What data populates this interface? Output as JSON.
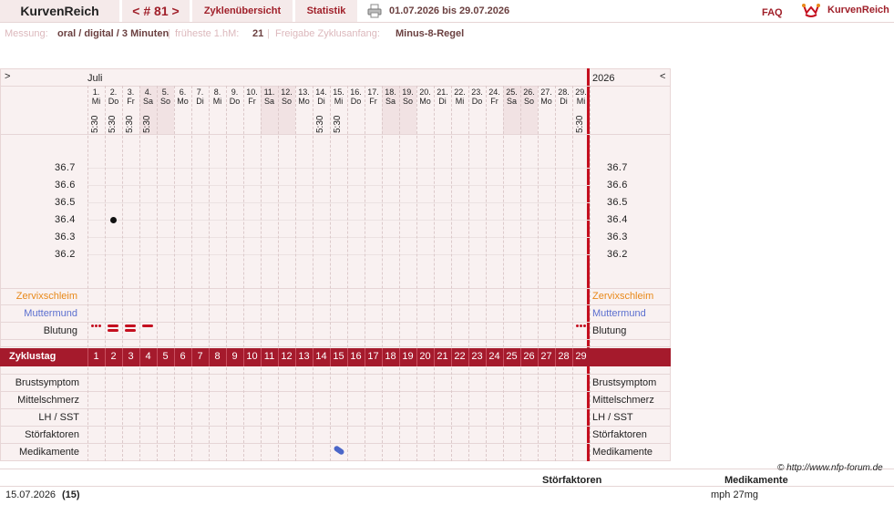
{
  "topbar": {
    "app": "KurvenReich",
    "cycle_nav": "< # 81 >",
    "tab_overview": "Zyklenübersicht",
    "tab_stats": "Statistik",
    "date_range": "01.07.2026 bis 29.07.2026",
    "faq": "FAQ",
    "logo_text": "KurvenReich"
  },
  "measurement": {
    "label_messung": "Messung:",
    "value_messung": "oral / digital / 3 Minuten",
    "label_earliest": "früheste 1.hM:",
    "value_earliest": "21",
    "label_release": "Freigabe Zyklusanfang:",
    "value_release": "Minus-8-Regel",
    "sep": "|"
  },
  "chart": {
    "left_arrow": ">",
    "right_arrow": "<",
    "month": "Juli",
    "year": "2026",
    "days": [
      {
        "n": "1.",
        "d": "Mi",
        "t": "5:30"
      },
      {
        "n": "2.",
        "d": "Do",
        "t": "5:30"
      },
      {
        "n": "3.",
        "d": "Fr",
        "t": "5:30"
      },
      {
        "n": "4.",
        "d": "Sa",
        "t": "5:30"
      },
      {
        "n": "5.",
        "d": "So",
        "t": ""
      },
      {
        "n": "6.",
        "d": "Mo",
        "t": ""
      },
      {
        "n": "7.",
        "d": "Di",
        "t": ""
      },
      {
        "n": "8.",
        "d": "Mi",
        "t": ""
      },
      {
        "n": "9.",
        "d": "Do",
        "t": ""
      },
      {
        "n": "10.",
        "d": "Fr",
        "t": ""
      },
      {
        "n": "11.",
        "d": "Sa",
        "t": ""
      },
      {
        "n": "12.",
        "d": "So",
        "t": ""
      },
      {
        "n": "13.",
        "d": "Mo",
        "t": ""
      },
      {
        "n": "14.",
        "d": "Di",
        "t": "5:30"
      },
      {
        "n": "15.",
        "d": "Mi",
        "t": "5:30"
      },
      {
        "n": "16.",
        "d": "Do",
        "t": ""
      },
      {
        "n": "17.",
        "d": "Fr",
        "t": ""
      },
      {
        "n": "18.",
        "d": "Sa",
        "t": ""
      },
      {
        "n": "19.",
        "d": "So",
        "t": ""
      },
      {
        "n": "20.",
        "d": "Mo",
        "t": ""
      },
      {
        "n": "21.",
        "d": "Di",
        "t": ""
      },
      {
        "n": "22.",
        "d": "Mi",
        "t": ""
      },
      {
        "n": "23.",
        "d": "Do",
        "t": ""
      },
      {
        "n": "24.",
        "d": "Fr",
        "t": ""
      },
      {
        "n": "25.",
        "d": "Sa",
        "t": ""
      },
      {
        "n": "26.",
        "d": "So",
        "t": ""
      },
      {
        "n": "27.",
        "d": "Mo",
        "t": ""
      },
      {
        "n": "28.",
        "d": "Di",
        "t": ""
      },
      {
        "n": "29.",
        "d": "Mi",
        "t": "5:30"
      }
    ],
    "temps": [
      "36.7",
      "36.6",
      "36.5",
      "36.4",
      "36.3",
      "36.2"
    ],
    "rows_top": {
      "cervix": "Zervixschleim",
      "cervix_color": "#e8891a",
      "mouth": "Muttermund",
      "mouth_color": "#5b6fcf",
      "bleeding": "Blutung"
    },
    "zyklustag_label": "Zyklustag",
    "cycle_days": [
      "1",
      "2",
      "3",
      "4",
      "5",
      "6",
      "7",
      "8",
      "9",
      "10",
      "11",
      "12",
      "13",
      "14",
      "15",
      "16",
      "17",
      "18",
      "19",
      "20",
      "21",
      "22",
      "23",
      "24",
      "25",
      "26",
      "27",
      "28",
      "29"
    ],
    "rows_bottom": [
      "Brustsymptom",
      "Mittelschmerz",
      "LH / SST",
      "Störfaktoren",
      "Medikamente"
    ],
    "temperature_points": [
      {
        "day": 2,
        "value": 36.4
      }
    ],
    "bleeding": [
      {
        "day": 1,
        "type": "dots"
      },
      {
        "day": 2,
        "type": "heavy"
      },
      {
        "day": 3,
        "type": "heavy"
      },
      {
        "day": 4,
        "type": "light"
      },
      {
        "day": 29,
        "type": "dots"
      }
    ],
    "medication_day": 15
  },
  "footer": {
    "copyright": "© http://www.nfp-forum.de",
    "col_stoer": "Störfaktoren",
    "col_med": "Medikamente",
    "entry_date": "15.07.2026",
    "entry_day": "(15)",
    "entry_med": "mph 27mg"
  },
  "colors": {
    "accent": "#a51a2c",
    "red": "#c40f1f"
  }
}
